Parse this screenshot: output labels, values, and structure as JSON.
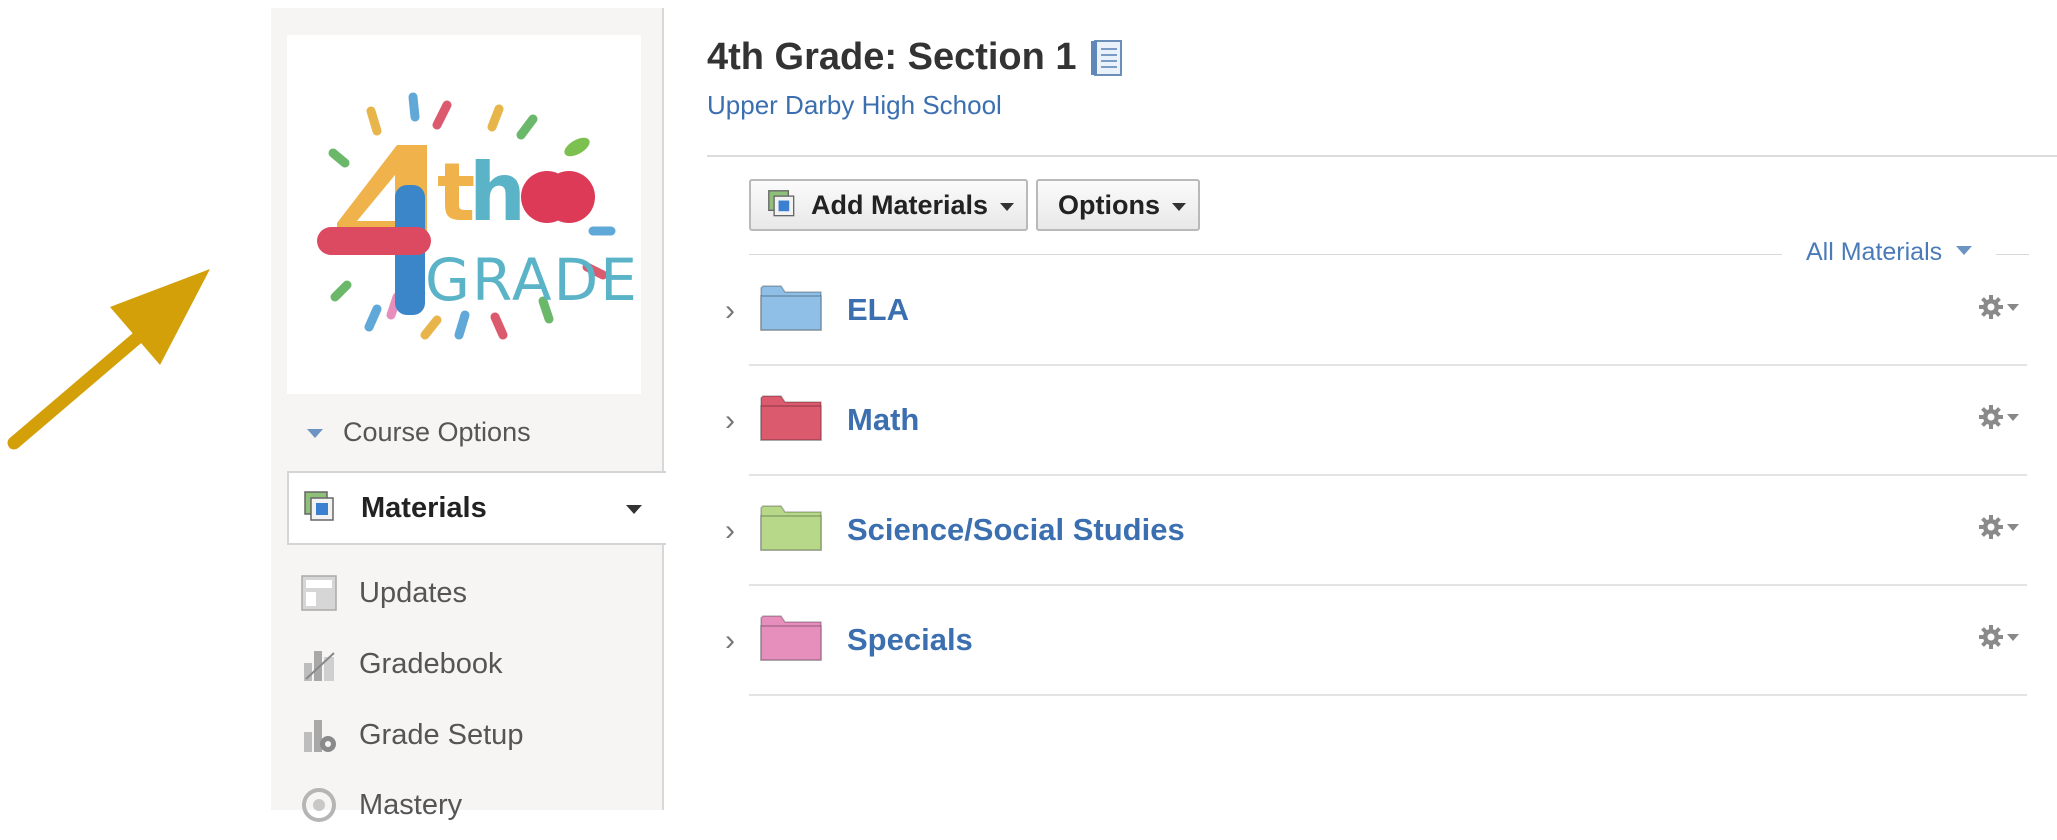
{
  "course": {
    "title": "4th Grade: Section 1",
    "school": "Upper Darby High School",
    "logo_text_top": "4th",
    "logo_text_bottom": "GRADE"
  },
  "sidebar": {
    "course_options_label": "Course Options",
    "items": [
      {
        "label": "Materials",
        "icon": "materials-icon",
        "active": true
      },
      {
        "label": "Updates",
        "icon": "updates-icon"
      },
      {
        "label": "Gradebook",
        "icon": "gradebook-icon"
      },
      {
        "label": "Grade Setup",
        "icon": "grade-setup-icon"
      },
      {
        "label": "Mastery",
        "icon": "mastery-icon"
      }
    ]
  },
  "toolbar": {
    "add_materials_label": "Add Materials",
    "options_label": "Options",
    "filter_label": "All Materials"
  },
  "folders": [
    {
      "name": "ELA",
      "color": "#8fbfe6"
    },
    {
      "name": "Math",
      "color": "#dc5a6e"
    },
    {
      "name": "Science/Social Studies",
      "color": "#b7d889"
    },
    {
      "name": "Specials",
      "color": "#e68fbd"
    }
  ],
  "colors": {
    "link": "#3b6fb0",
    "annotation_arrow": "#d4a00a"
  }
}
